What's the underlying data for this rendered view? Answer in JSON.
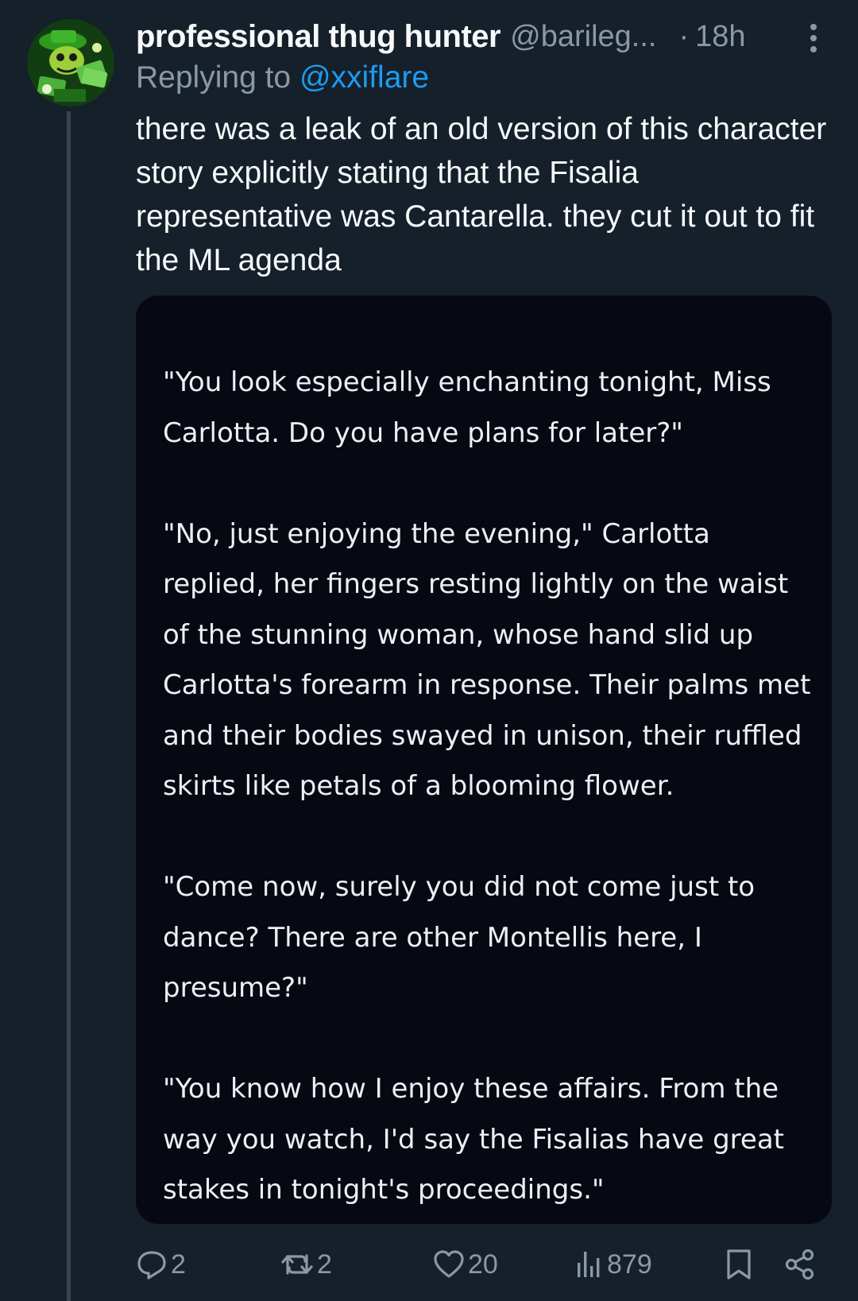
{
  "tweet": {
    "display_name": "professional thug hunter",
    "handle": "@barileg...",
    "separator": "·",
    "time": "18h",
    "reply_prefix": "Replying to",
    "reply_to": "@xxiflare",
    "text": "there was a leak of an old version of this character story explicitly stating that the Fisalia representative was Cantarella. they cut it out to fit the ML agenda"
  },
  "media": {
    "paragraphs": [
      "\"You look especially enchanting tonight, Miss Carlotta. Do you have plans for later?\"",
      "\"No, just enjoying the evening,\" Carlotta replied, her fingers resting lightly on the waist of the stunning woman, whose hand slid up Carlotta's forearm in response. Their palms met and their bodies swayed in unison, their ruffled skirts like petals of a blooming flower.",
      "\"Come now, surely you did not come just to dance? There are other Montellis here, I presume?\"",
      "\"You know how I enjoy these affairs. From the way you watch, I'd say the Fisalias have great stakes in tonight's proceedings.\""
    ]
  },
  "actions": {
    "replies": "2",
    "reposts": "2",
    "likes": "20",
    "views": "879"
  },
  "icons": {
    "avatar": "avatar-image",
    "more": "more-vertical-icon",
    "reply": "reply-icon",
    "repost": "repost-icon",
    "like": "heart-icon",
    "views": "views-icon",
    "bookmark": "bookmark-icon",
    "share": "share-icon"
  },
  "colors": {
    "background": "#15202b",
    "text": "#f7f9f9",
    "muted": "#8b98a5",
    "link": "#1d9bf0",
    "media_background": "#080812"
  }
}
